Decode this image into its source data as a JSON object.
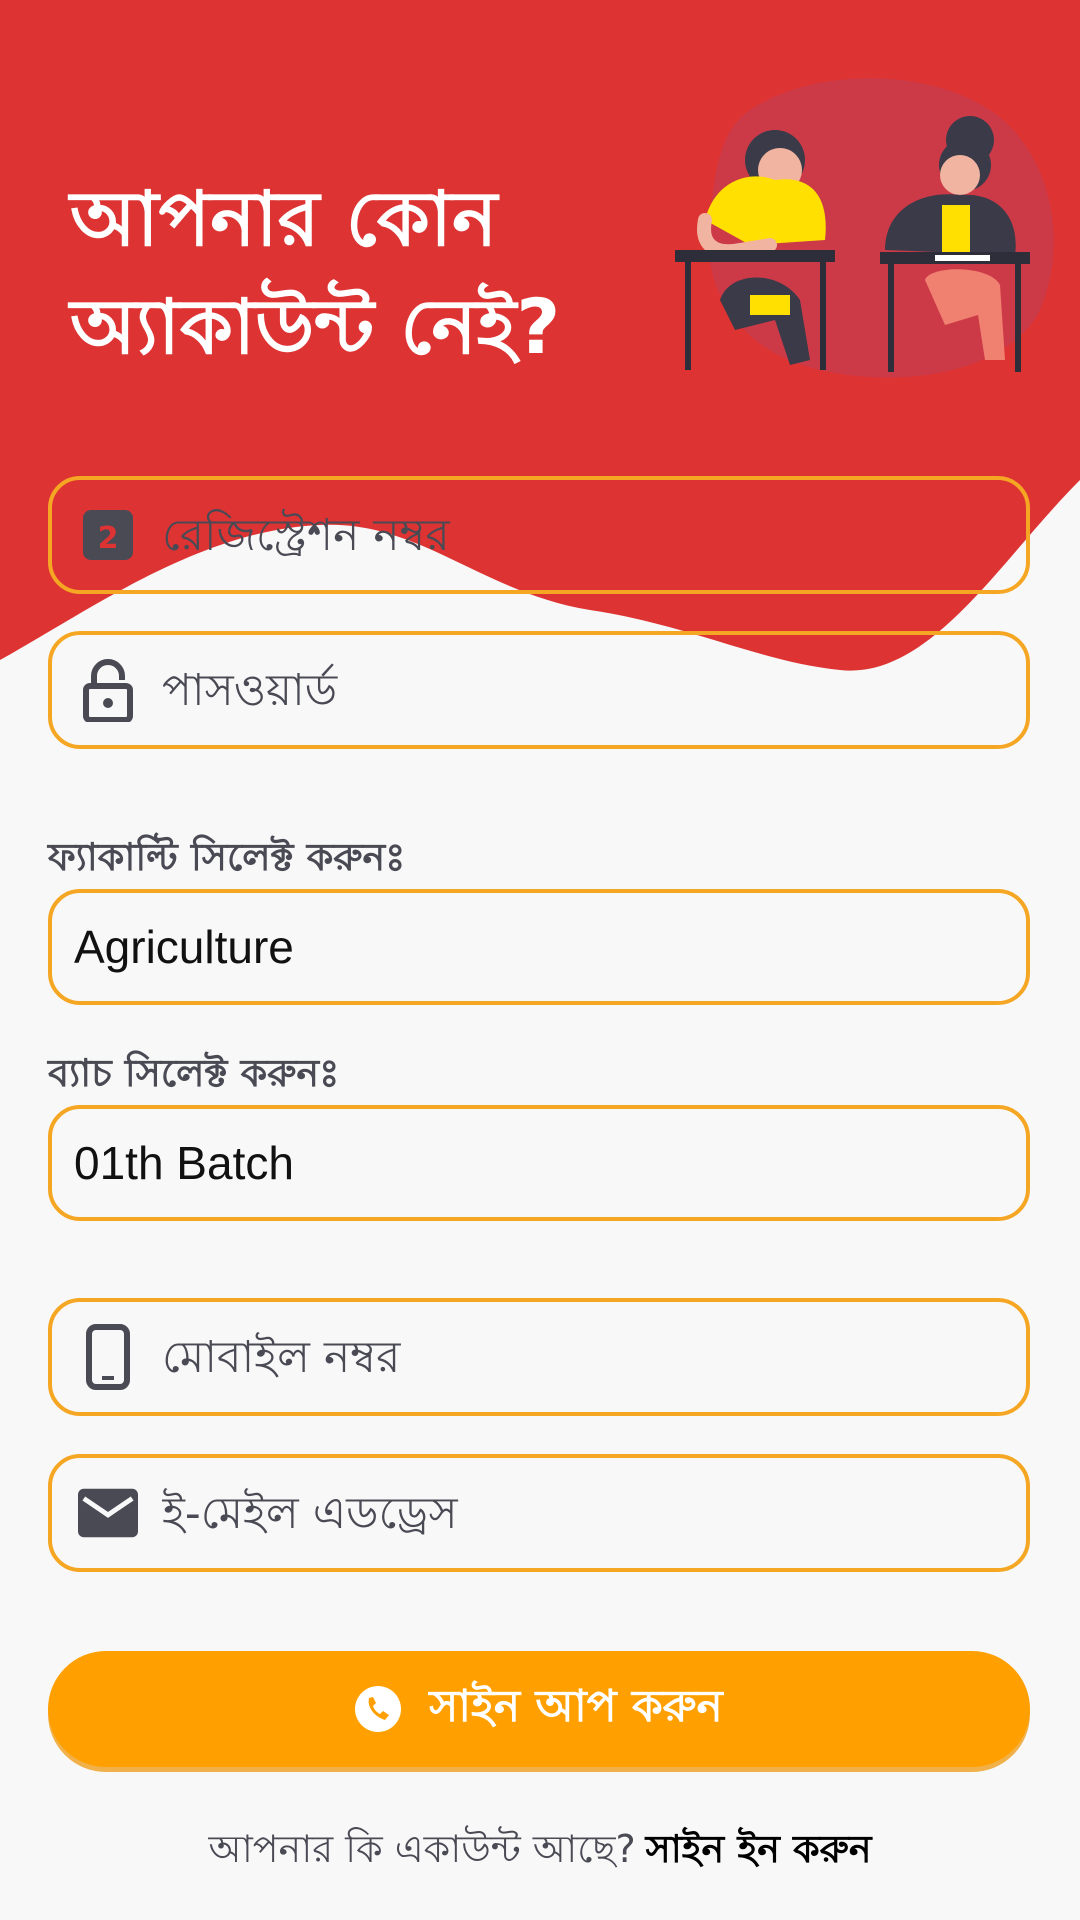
{
  "colors": {
    "brand_red": "#de3333",
    "accent_orange": "#ffa000",
    "field_border": "#f5a623",
    "text_gray": "#4a4a55"
  },
  "hero": {
    "title_line1": "আপনার কোন",
    "title_line2": "অ্যাকাউন্ট নেই?",
    "illustration": "students-writing-exam-illustration"
  },
  "form": {
    "registration": {
      "placeholder": "রেজিস্ট্রেশন নম্বর",
      "icon": "id-card-icon"
    },
    "password": {
      "placeholder": "পাসওয়ার্ড",
      "icon": "lock-icon"
    },
    "faculty": {
      "label": "ফ্যাকাল্টি সিলেক্ট করুনঃ",
      "selected": "Agriculture"
    },
    "batch": {
      "label": "ব্যাচ সিলেক্ট করুনঃ",
      "selected": "01th Batch"
    },
    "mobile": {
      "placeholder": "মোবাইল নম্বর",
      "icon": "mobile-phone-icon"
    },
    "email": {
      "placeholder": "ই-মেইল এডড্রেস",
      "icon": "envelope-icon"
    }
  },
  "signup_button": {
    "label": "সাইন আপ করুন",
    "icon": "phone-icon"
  },
  "footer": {
    "question": "আপনার কি একাউন্ট আছে?",
    "signin_link": "সাইন ইন করুন"
  }
}
